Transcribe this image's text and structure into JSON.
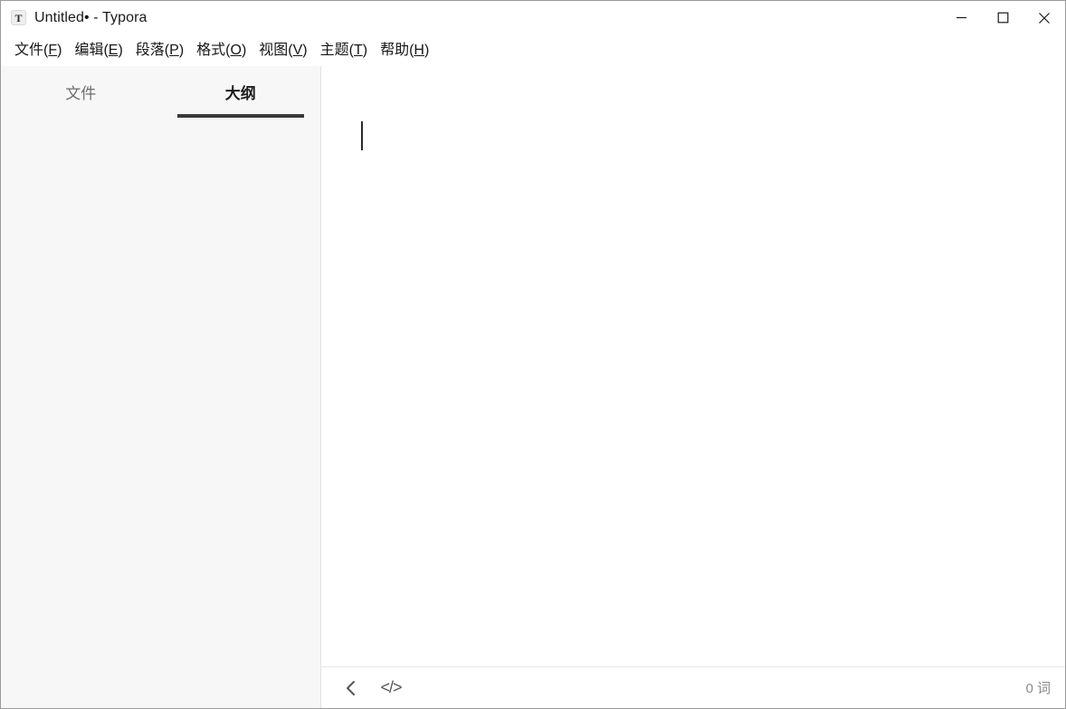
{
  "window": {
    "title": "Untitled• - Typora",
    "logo_letter": "T",
    "logo_icon": "typora-logo-icon",
    "controls": [
      {
        "name": "minimize-button",
        "icon": "minimize-icon"
      },
      {
        "name": "maximize-button",
        "icon": "maximize-icon"
      },
      {
        "name": "close-button",
        "icon": "close-icon"
      }
    ]
  },
  "menubar": {
    "items": [
      {
        "label": "文件(F)",
        "text": "文件(",
        "accel": "F",
        "tail": ")"
      },
      {
        "label": "编辑(E)",
        "text": "编辑(",
        "accel": "E",
        "tail": ")"
      },
      {
        "label": "段落(P)",
        "text": "段落(",
        "accel": "P",
        "tail": ")"
      },
      {
        "label": "格式(O)",
        "text": "格式(",
        "accel": "O",
        "tail": ")"
      },
      {
        "label": "视图(V)",
        "text": "视图(",
        "accel": "V",
        "tail": ")"
      },
      {
        "label": "主题(T)",
        "text": "主题(",
        "accel": "T",
        "tail": ")"
      },
      {
        "label": "帮助(H)",
        "text": "帮助(",
        "accel": "H",
        "tail": ")"
      }
    ]
  },
  "sidebar": {
    "tabs": [
      {
        "label": "文件",
        "active": false
      },
      {
        "label": "大纲",
        "active": true
      }
    ]
  },
  "editor": {
    "content": "",
    "caret_visible": true
  },
  "statusbar": {
    "sidebar_toggle_icon": "chevron-left-icon",
    "source_mode_icon": "source-code-icon",
    "source_mode_glyph": "</>",
    "word_count": "0 词"
  },
  "colors": {
    "accent_underline": "#3a3a3a",
    "sidebar_bg": "#f7f7f7",
    "editor_bg": "#ffffff",
    "muted_text": "#8a8a8a"
  }
}
